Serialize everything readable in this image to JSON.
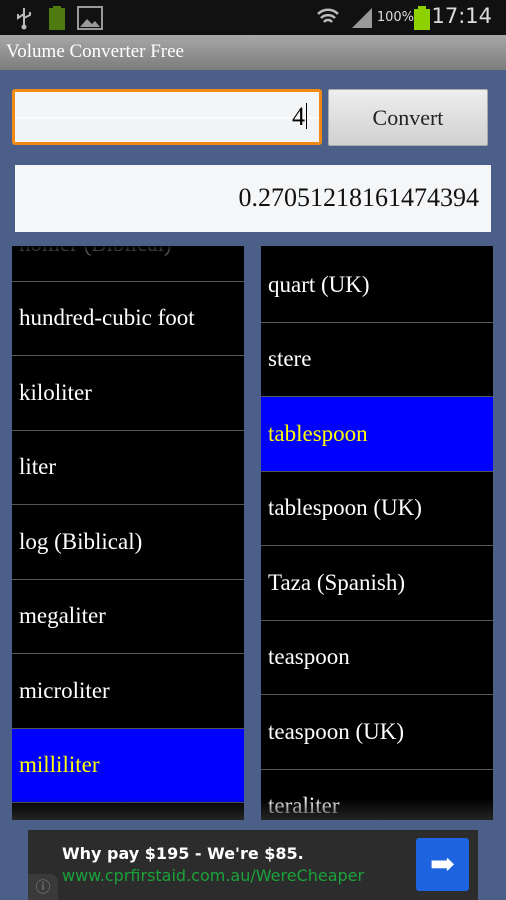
{
  "status": {
    "time": "17:14",
    "battery": "100%",
    "icons": [
      "usb-icon",
      "battery-small-icon",
      "image-icon",
      "wifi-icon",
      "signal-icon",
      "battery-icon"
    ]
  },
  "app": {
    "title": "Volume Converter Free"
  },
  "input": {
    "value": "4"
  },
  "convert_label": "Convert",
  "result": "0.27051218161474394",
  "left_list": {
    "items": [
      "homer (Biblical)",
      "hundred-cubic foot",
      "kiloliter",
      "liter",
      "log (Biblical)",
      "megaliter",
      "microliter",
      "milliliter",
      ""
    ],
    "selected": "milliliter"
  },
  "right_list": {
    "items": [
      "quart (UK)",
      "stere",
      "tablespoon",
      "tablespoon (UK)",
      "Taza (Spanish)",
      "teaspoon",
      "teaspoon (UK)",
      "teraliter"
    ],
    "selected": "tablespoon"
  },
  "colors": {
    "background": "#4b5f88",
    "selected_bg": "#0000ff",
    "selected_text": "#ffff00",
    "focus": "#f08a14"
  },
  "ad": {
    "headline": "Why pay $195 - We're $85.",
    "url": "www.cprfirstaid.com.au/WereCheaper"
  }
}
